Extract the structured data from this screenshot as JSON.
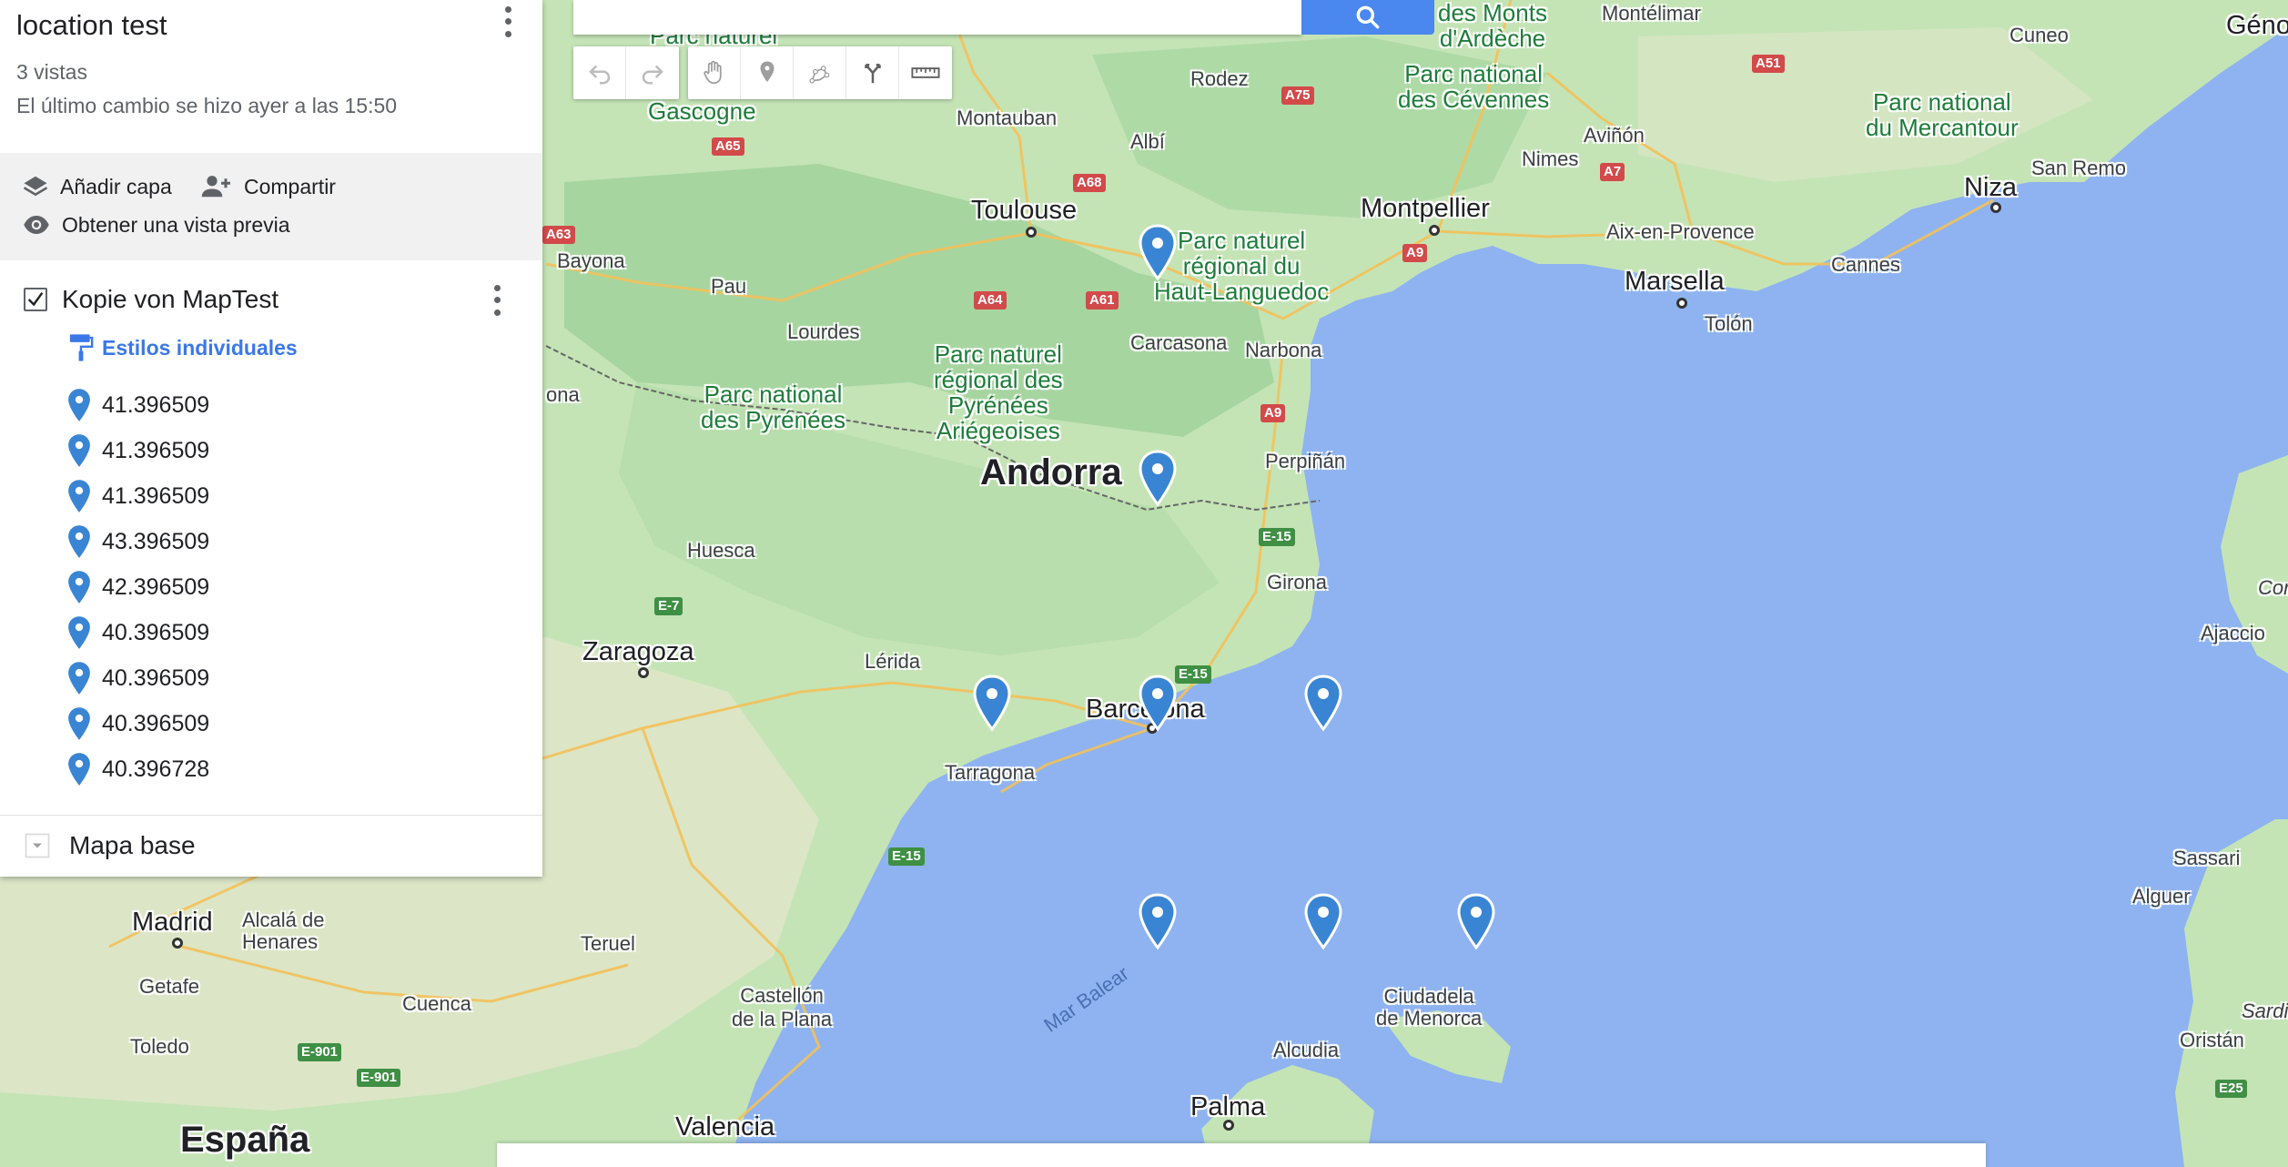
{
  "map_info": {
    "title": "location test",
    "views": "3 vistas",
    "last_change": "El último cambio se hizo ayer a las 15:50"
  },
  "actions": {
    "add_layer": "Añadir capa",
    "share": "Compartir",
    "preview": "Obtener una vista previa"
  },
  "layer": {
    "name": "Kopie von MapTest",
    "styles_label": "Estilos individuales",
    "features": [
      "41.396509",
      "41.396509",
      "41.396509",
      "43.396509",
      "42.396509",
      "40.396509",
      "40.396509",
      "40.396509",
      "40.396728"
    ]
  },
  "basemap": {
    "label": "Mapa base"
  },
  "toolbar": {
    "icons": [
      "undo-icon",
      "redo-icon",
      "hand-icon",
      "add-marker-icon",
      "draw-line-icon",
      "directions-icon",
      "ruler-icon"
    ]
  },
  "colors": {
    "accent": "#3b78e7",
    "pin": "#3a85d3",
    "water": "#8eb3f0",
    "land": "#a8d5a3"
  },
  "map_labels": {
    "cities": {
      "toulouse": "Toulouse",
      "montpellier": "Montpellier",
      "marsella": "Marsella",
      "niza": "Niza",
      "zaragoza": "Zaragoza",
      "barcelona": "Barcelona",
      "madrid": "Madrid",
      "valencia": "Valencia",
      "palma": "Palma"
    },
    "towns": {
      "montelimar": "Montélimar",
      "cuneo": "Cuneo",
      "geno": "Géno",
      "rodez": "Rodez",
      "albi": "Albí",
      "montauban": "Montauban",
      "gascogne": "Gascogne",
      "nimes": "Nimes",
      "avinon": "Aviñón",
      "aix": "Aix-en-Provence",
      "cannes": "Cannes",
      "sanremo": "San Remo",
      "tolon": "Tolón",
      "bayona": "Bayona",
      "pau": "Pau",
      "lourdes": "Lourdes",
      "carcasona": "Carcasona",
      "narbona": "Narbona",
      "perpinan": "Perpiñán",
      "huesca": "Huesca",
      "girona": "Girona",
      "lerida": "Lérida",
      "tarragona": "Tarragona",
      "teruel": "Teruel",
      "cuenca": "Cuenca",
      "toledo": "Toledo",
      "getafe": "Getafe",
      "alcala": "Alcalá de\nHenares",
      "castellon": "Castellón\nde la Plana",
      "ciudadela": "Ciudadela\nde Menorca",
      "alcudia": "Alcudia",
      "sassari": "Sassari",
      "alguer": "Alguer",
      "ajaccio": "Ajaccio",
      "oristan": "Oristán",
      "sardi": "Sardi",
      "cor": "Cor",
      "ona": "ona"
    },
    "country": "Andorra",
    "country_spain": "España",
    "sea": "Mar Balear",
    "parks": {
      "cevennes": "Parc national\ndes Cévennes",
      "monts": "des Monts\nd'Ardèche",
      "mercantour": "Parc national\ndu Mercantour",
      "haut_languedoc": "Parc naturel\nrégional du\nHaut-Languedoc",
      "pyrenees_ariegeoises": "Parc naturel\nrégional des\nPyrénées\nAriégeoises",
      "pyrenees": "Parc national\ndes Pyrénées",
      "parc_top": "Parc naturel"
    },
    "highways": {
      "a51": "A51",
      "a75": "A75",
      "a65": "A65",
      "a68": "A68",
      "a7": "A7",
      "a9a": "A9",
      "a63": "A63",
      "a64": "A64",
      "a61": "A61",
      "a9b": "A9",
      "e15a": "E-15",
      "e7": "E-7",
      "e15b": "E-15",
      "e15c": "E-15",
      "e901a": "E-901",
      "e901b": "E-901",
      "e25": "E25"
    }
  }
}
